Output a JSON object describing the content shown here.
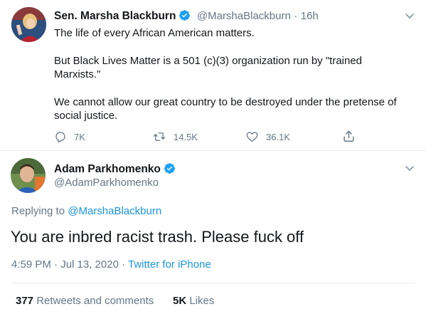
{
  "tweet1": {
    "name": "Sen. Marsha Blackburn",
    "handle": "@MarshaBlackburn",
    "time": "16h",
    "lines": [
      "The life of every African American matters.",
      "But Black Lives Matter is a 501 (c)(3) organization run by \"trained",
      "Marxists.\"",
      "We cannot allow our great country to be destroyed under the pretense of",
      "social justice."
    ],
    "replies": "7K",
    "retweets": "14.5K",
    "likes": "36.1K"
  },
  "tweet2": {
    "name": "Adam Parkhomenko",
    "handle": "@AdamParkhomenko",
    "replying_prefix": "Replying to",
    "replying_handle": "@MarshaBlackburn",
    "text": "You are inbred racist trash. Please fuck off",
    "timestamp": "4:59 PM · Jul 13, 2020",
    "separator": "·",
    "source": "Twitter for iPhone",
    "retweets_count": "377",
    "retweets_label": "Retweets and comments",
    "likes_count": "5K",
    "likes_label": "Likes"
  },
  "colors": {
    "verified": "#1da1f2",
    "link": "#1b95e0",
    "muted": "#657786"
  }
}
